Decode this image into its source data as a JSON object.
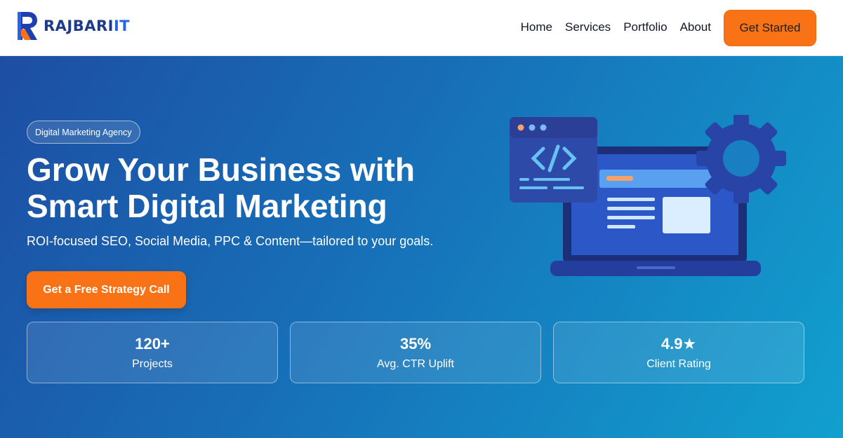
{
  "brand": {
    "name": "RAJBARI",
    "suffix": "IT"
  },
  "nav": {
    "items": [
      "Home",
      "Services",
      "Portfolio",
      "About"
    ],
    "cta_label": "Get Started"
  },
  "hero": {
    "badge": "Digital Marketing Agency",
    "headline_line1": "Grow Your Business with",
    "headline_line2": "Smart Digital Marketing",
    "subheadline": "ROI-focused SEO, Social Media, PPC & Content—tailored to your goals.",
    "cta_label": "Get a Free Strategy Call"
  },
  "stats": [
    {
      "value": "120+",
      "label": "Projects"
    },
    {
      "value": "35%",
      "label": "Avg. CTR Uplift"
    },
    {
      "value": "4.9★",
      "label": "Client Rating"
    }
  ],
  "colors": {
    "accent": "#f97316",
    "brand": "#1e3a8a",
    "hero_start": "#1d4ea3",
    "hero_end": "#11a0cf"
  },
  "icons": [
    "code-window-icon",
    "laptop-icon",
    "gear-icon"
  ]
}
